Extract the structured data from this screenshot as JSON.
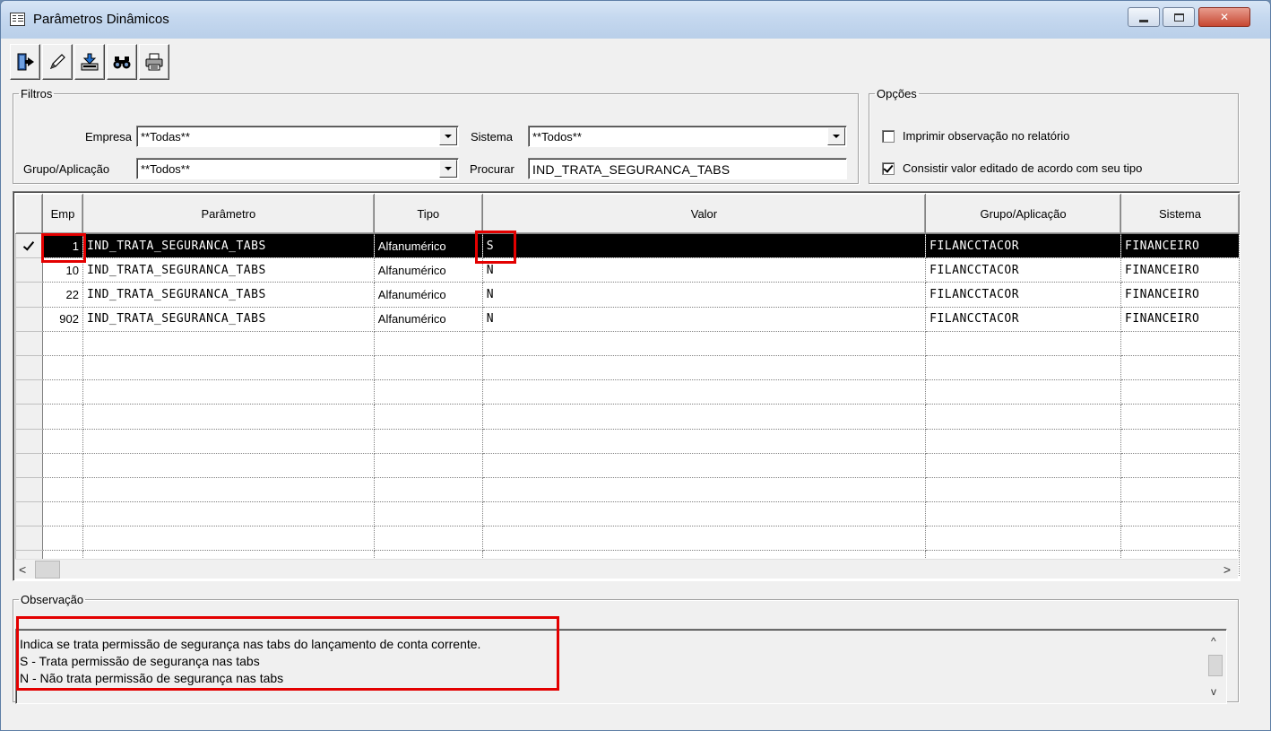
{
  "window": {
    "title": "Parâmetros Dinâmicos"
  },
  "toolbar": {
    "buttons": [
      {
        "name": "exit-icon"
      },
      {
        "name": "edit-icon"
      },
      {
        "name": "import-icon"
      },
      {
        "name": "binoculars-icon"
      },
      {
        "name": "print-icon"
      }
    ]
  },
  "filtros": {
    "legend": "Filtros",
    "empresa_label": "Empresa",
    "empresa_value": "**Todas**",
    "sistema_label": "Sistema",
    "sistema_value": "**Todos**",
    "grupo_label": "Grupo/Aplicação",
    "grupo_value": "**Todos**",
    "procurar_label": "Procurar",
    "procurar_value": "IND_TRATA_SEGURANCA_TABS"
  },
  "opcoes": {
    "legend": "Opções",
    "imprimir_label": "Imprimir observação no relatório",
    "imprimir_checked": false,
    "consistir_label": "Consistir valor editado de acordo com seu tipo",
    "consistir_checked": true
  },
  "grid": {
    "columns": [
      "Emp",
      "Parâmetro",
      "Tipo",
      "Valor",
      "Grupo/Aplicação",
      "Sistema"
    ],
    "rows": [
      {
        "emp": "1",
        "parametro": "IND_TRATA_SEGURANCA_TABS",
        "tipo": "Alfanumérico",
        "valor": "S",
        "grupo": "FILANCCTACOR",
        "sistema": "FINANCEIRO"
      },
      {
        "emp": "10",
        "parametro": "IND_TRATA_SEGURANCA_TABS",
        "tipo": "Alfanumérico",
        "valor": "N",
        "grupo": "FILANCCTACOR",
        "sistema": "FINANCEIRO"
      },
      {
        "emp": "22",
        "parametro": "IND_TRATA_SEGURANCA_TABS",
        "tipo": "Alfanumérico",
        "valor": "N",
        "grupo": "FILANCCTACOR",
        "sistema": "FINANCEIRO"
      },
      {
        "emp": "902",
        "parametro": "IND_TRATA_SEGURANCA_TABS",
        "tipo": "Alfanumérico",
        "valor": "N",
        "grupo": "FILANCCTACOR",
        "sistema": "FINANCEIRO"
      }
    ],
    "selected_row": 0
  },
  "observacao": {
    "legend": "Observação",
    "lines": [
      "Indica se trata permissão de segurança nas tabs do lançamento de conta corrente.",
      "S - Trata permissão de segurança nas tabs",
      "N - Não trata permissão de segurança nas tabs"
    ]
  },
  "colors": {
    "highlight": "#e30000",
    "selected_row_bg": "#000000",
    "window_bg": "#f0f0f0"
  }
}
